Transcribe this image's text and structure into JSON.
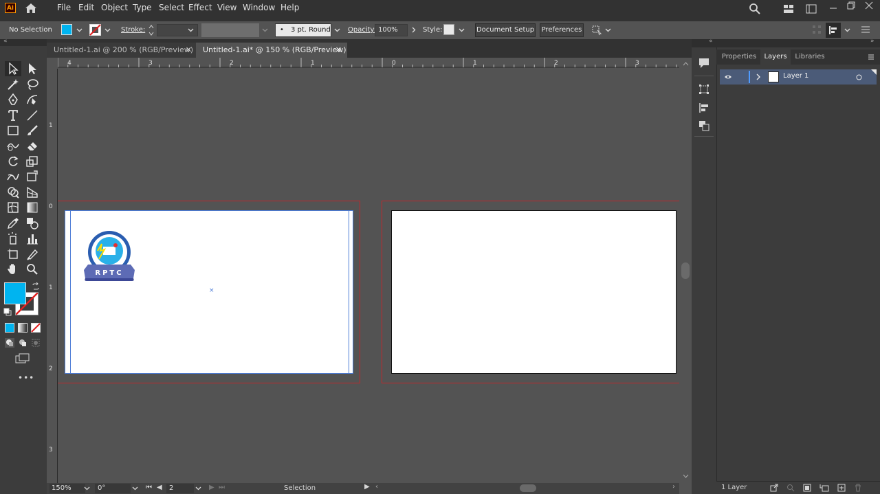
{
  "app": {
    "logo": "Ai"
  },
  "menu": [
    "File",
    "Edit",
    "Object",
    "Type",
    "Select",
    "Effect",
    "View",
    "Window",
    "Help"
  ],
  "control": {
    "selection_label": "No Selection",
    "stroke_label": "Stroke:",
    "brush_label": "3 pt. Round",
    "opacity_label": "Opacity:",
    "opacity_value": "100%",
    "style_label": "Style:",
    "document_setup": "Document Setup",
    "preferences": "Preferences"
  },
  "tabs": [
    {
      "label": "Untitled-1.ai @ 200 % (RGB/Preview)",
      "active": false
    },
    {
      "label": "Untitled-1.ai* @ 150 % (RGB/Preview)",
      "active": true
    }
  ],
  "ruler": {
    "h_ticks": [
      "4",
      "3",
      "2",
      "1",
      "0",
      "1",
      "2",
      "3"
    ],
    "v_ticks": [
      "1",
      "0",
      "1",
      "2",
      "3"
    ]
  },
  "logo": {
    "text": "RPTC"
  },
  "panel": {
    "tabs": [
      "Properties",
      "Layers",
      "Libraries"
    ],
    "active_tab": "Layers",
    "layers": [
      {
        "name": "Layer 1"
      }
    ],
    "footer": "1 Layer"
  },
  "status": {
    "zoom": "150%",
    "rotation": "0°",
    "artboard": "2",
    "tool": "Selection"
  },
  "colors": {
    "fill": "#00b4f0",
    "accent": "#4b7bd6",
    "bleed": "#c0282d",
    "ui_dark": "#323232",
    "ui_mid": "#535353"
  },
  "icons": [
    "ai-logo",
    "home-icon",
    "search-icon",
    "arrange-icon",
    "workspace-icon",
    "minimize-icon",
    "restore-icon",
    "close-icon",
    "selection-tool-icon",
    "direct-selection-icon",
    "magic-wand-icon",
    "lasso-icon",
    "pen-icon",
    "curvature-icon",
    "type-icon",
    "line-icon",
    "rectangle-icon",
    "paintbrush-icon",
    "shaper-icon",
    "eraser-icon",
    "rotate-icon",
    "scale-icon",
    "warp-icon",
    "free-transform-icon",
    "shape-builder-icon",
    "perspective-icon",
    "mesh-icon",
    "gradient-icon",
    "eyedropper-icon",
    "blend-icon",
    "symbol-sprayer-icon",
    "graph-icon",
    "artboard-tool-icon",
    "slice-icon",
    "hand-icon",
    "zoom-icon",
    "eye-icon",
    "chevron-right-icon",
    "comment-icon",
    "transform-icon",
    "align-icon",
    "pathfinder-icon"
  ]
}
